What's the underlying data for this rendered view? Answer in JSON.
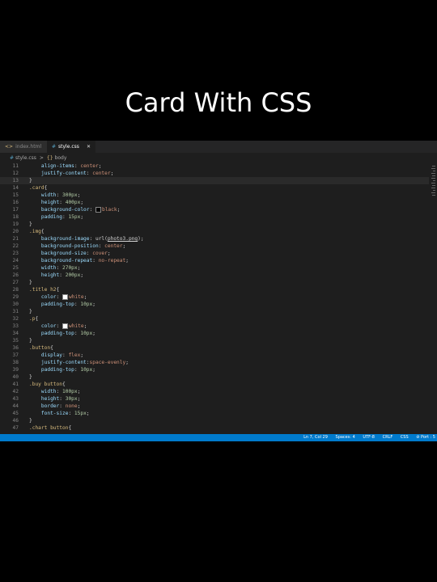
{
  "headline": "Card With CSS",
  "tabs": [
    {
      "icon": "<>",
      "label": "index.html",
      "active": false
    },
    {
      "icon": "#",
      "label": "style.css",
      "active": true,
      "close": "✕"
    }
  ],
  "breadcrumb": {
    "file_icon": "#",
    "file": "style.css",
    "separator": ">",
    "node_icon": "{}",
    "node": "body"
  },
  "code_lines": [
    {
      "n": "11",
      "tokens": [
        {
          "t": "    "
        },
        {
          "c": "prop",
          "t": "align-items"
        },
        {
          "c": "pun",
          "t": ": "
        },
        {
          "c": "val",
          "t": "center"
        },
        {
          "c": "pun",
          "t": ";"
        }
      ]
    },
    {
      "n": "12",
      "tokens": [
        {
          "t": "    "
        },
        {
          "c": "prop",
          "t": "justify-content"
        },
        {
          "c": "pun",
          "t": ": "
        },
        {
          "c": "val",
          "t": "center"
        },
        {
          "c": "pun",
          "t": ";"
        }
      ]
    },
    {
      "n": "13",
      "cur": true,
      "tokens": [
        {
          "c": "pun",
          "t": "}"
        }
      ]
    },
    {
      "n": "14",
      "tokens": [
        {
          "c": "sel",
          "t": ".card"
        },
        {
          "c": "pun",
          "t": "{"
        }
      ]
    },
    {
      "n": "15",
      "tokens": [
        {
          "t": "    "
        },
        {
          "c": "prop",
          "t": "width"
        },
        {
          "c": "pun",
          "t": ": "
        },
        {
          "c": "num",
          "t": "300px"
        },
        {
          "c": "pun",
          "t": ";"
        }
      ]
    },
    {
      "n": "16",
      "tokens": [
        {
          "t": "    "
        },
        {
          "c": "prop",
          "t": "height"
        },
        {
          "c": "pun",
          "t": ": "
        },
        {
          "c": "num",
          "t": "400px"
        },
        {
          "c": "pun",
          "t": ";"
        }
      ]
    },
    {
      "n": "17",
      "tokens": [
        {
          "t": "    "
        },
        {
          "c": "prop",
          "t": "background-color"
        },
        {
          "c": "pun",
          "t": ": "
        },
        {
          "c": "swatch-black",
          "t": ""
        },
        {
          "c": "val",
          "t": "black"
        },
        {
          "c": "pun",
          "t": ";"
        }
      ]
    },
    {
      "n": "18",
      "tokens": [
        {
          "t": "    "
        },
        {
          "c": "prop",
          "t": "padding"
        },
        {
          "c": "pun",
          "t": ": "
        },
        {
          "c": "num",
          "t": "15px"
        },
        {
          "c": "pun",
          "t": ";"
        }
      ]
    },
    {
      "n": "19",
      "tokens": [
        {
          "c": "pun",
          "t": "}"
        }
      ]
    },
    {
      "n": "20",
      "tokens": [
        {
          "c": "sel",
          "t": ".img"
        },
        {
          "c": "pun",
          "t": "{"
        }
      ]
    },
    {
      "n": "21",
      "tokens": [
        {
          "t": "    "
        },
        {
          "c": "prop",
          "t": "background-image"
        },
        {
          "c": "pun",
          "t": ": url("
        },
        {
          "c": "url",
          "t": "photo3.png"
        },
        {
          "c": "pun",
          "t": ");"
        }
      ]
    },
    {
      "n": "22",
      "tokens": [
        {
          "t": "    "
        },
        {
          "c": "prop",
          "t": "background-position"
        },
        {
          "c": "pun",
          "t": ": "
        },
        {
          "c": "val",
          "t": "center"
        },
        {
          "c": "pun",
          "t": ";"
        }
      ]
    },
    {
      "n": "23",
      "tokens": [
        {
          "t": "    "
        },
        {
          "c": "prop",
          "t": "background-size"
        },
        {
          "c": "pun",
          "t": ": "
        },
        {
          "c": "val",
          "t": "cover"
        },
        {
          "c": "pun",
          "t": ";"
        }
      ]
    },
    {
      "n": "24",
      "tokens": [
        {
          "t": "    "
        },
        {
          "c": "prop",
          "t": "background-repeat"
        },
        {
          "c": "pun",
          "t": ": "
        },
        {
          "c": "val",
          "t": "no-repeat"
        },
        {
          "c": "pun",
          "t": ";"
        }
      ]
    },
    {
      "n": "25",
      "tokens": [
        {
          "t": "    "
        },
        {
          "c": "prop",
          "t": "width"
        },
        {
          "c": "pun",
          "t": ": "
        },
        {
          "c": "num",
          "t": "270px"
        },
        {
          "c": "pun",
          "t": ";"
        }
      ]
    },
    {
      "n": "26",
      "tokens": [
        {
          "t": "    "
        },
        {
          "c": "prop",
          "t": "height"
        },
        {
          "c": "pun",
          "t": ": "
        },
        {
          "c": "num",
          "t": "200px"
        },
        {
          "c": "pun",
          "t": ";"
        }
      ]
    },
    {
      "n": "27",
      "tokens": [
        {
          "c": "pun",
          "t": "}"
        }
      ]
    },
    {
      "n": "28",
      "tokens": [
        {
          "c": "sel",
          "t": ".title h2"
        },
        {
          "c": "pun",
          "t": "{"
        }
      ]
    },
    {
      "n": "29",
      "tokens": [
        {
          "t": "    "
        },
        {
          "c": "prop",
          "t": "color"
        },
        {
          "c": "pun",
          "t": ": "
        },
        {
          "c": "swatch-white",
          "t": ""
        },
        {
          "c": "val",
          "t": "white"
        },
        {
          "c": "pun",
          "t": ";"
        }
      ]
    },
    {
      "n": "30",
      "tokens": [
        {
          "t": "    "
        },
        {
          "c": "prop",
          "t": "padding-top"
        },
        {
          "c": "pun",
          "t": ": "
        },
        {
          "c": "num",
          "t": "10px"
        },
        {
          "c": "pun",
          "t": ";"
        }
      ]
    },
    {
      "n": "31",
      "tokens": [
        {
          "c": "pun",
          "t": "}"
        }
      ]
    },
    {
      "n": "32",
      "tokens": [
        {
          "c": "sel",
          "t": ".p"
        },
        {
          "c": "pun",
          "t": "{"
        }
      ]
    },
    {
      "n": "33",
      "tokens": [
        {
          "t": "    "
        },
        {
          "c": "prop",
          "t": "color"
        },
        {
          "c": "pun",
          "t": ": "
        },
        {
          "c": "swatch-white",
          "t": ""
        },
        {
          "c": "val",
          "t": "white"
        },
        {
          "c": "pun",
          "t": ";"
        }
      ]
    },
    {
      "n": "34",
      "tokens": [
        {
          "t": "    "
        },
        {
          "c": "prop",
          "t": "padding-top"
        },
        {
          "c": "pun",
          "t": ": "
        },
        {
          "c": "num",
          "t": "10px"
        },
        {
          "c": "pun",
          "t": ";"
        }
      ]
    },
    {
      "n": "35",
      "tokens": [
        {
          "c": "pun",
          "t": "}"
        }
      ]
    },
    {
      "n": "36",
      "tokens": [
        {
          "c": "sel",
          "t": ".button"
        },
        {
          "c": "pun",
          "t": "{"
        }
      ]
    },
    {
      "n": "37",
      "tokens": [
        {
          "t": "    "
        },
        {
          "c": "prop",
          "t": "display"
        },
        {
          "c": "pun",
          "t": ": "
        },
        {
          "c": "val",
          "t": "flex"
        },
        {
          "c": "pun",
          "t": ";"
        }
      ]
    },
    {
      "n": "38",
      "tokens": [
        {
          "t": "    "
        },
        {
          "c": "prop",
          "t": "justify-content"
        },
        {
          "c": "pun",
          "t": ":"
        },
        {
          "c": "val",
          "t": "space-evenly"
        },
        {
          "c": "pun",
          "t": ";"
        }
      ]
    },
    {
      "n": "39",
      "tokens": [
        {
          "t": "    "
        },
        {
          "c": "prop",
          "t": "padding-top"
        },
        {
          "c": "pun",
          "t": ": "
        },
        {
          "c": "num",
          "t": "10px"
        },
        {
          "c": "pun",
          "t": ";"
        }
      ]
    },
    {
      "n": "40",
      "tokens": [
        {
          "c": "pun",
          "t": "}"
        }
      ]
    },
    {
      "n": "41",
      "tokens": [
        {
          "c": "sel",
          "t": ".buy button"
        },
        {
          "c": "pun",
          "t": "{"
        }
      ]
    },
    {
      "n": "42",
      "tokens": [
        {
          "t": "    "
        },
        {
          "c": "prop",
          "t": "width"
        },
        {
          "c": "pun",
          "t": ": "
        },
        {
          "c": "num",
          "t": "100px"
        },
        {
          "c": "pun",
          "t": ";"
        }
      ]
    },
    {
      "n": "43",
      "tokens": [
        {
          "t": "    "
        },
        {
          "c": "prop",
          "t": "height"
        },
        {
          "c": "pun",
          "t": ": "
        },
        {
          "c": "num",
          "t": "30px"
        },
        {
          "c": "pun",
          "t": ";"
        }
      ]
    },
    {
      "n": "44",
      "tokens": [
        {
          "t": "    "
        },
        {
          "c": "prop",
          "t": "border"
        },
        {
          "c": "pun",
          "t": ": "
        },
        {
          "c": "val",
          "t": "none"
        },
        {
          "c": "pun",
          "t": ";"
        }
      ]
    },
    {
      "n": "45",
      "tokens": [
        {
          "t": "    "
        },
        {
          "c": "prop",
          "t": "font-size"
        },
        {
          "c": "pun",
          "t": ": "
        },
        {
          "c": "num",
          "t": "15px"
        },
        {
          "c": "pun",
          "t": ";"
        }
      ]
    },
    {
      "n": "46",
      "tokens": [
        {
          "c": "pun",
          "t": "}"
        }
      ]
    },
    {
      "n": "47",
      "tokens": [
        {
          "c": "sel",
          "t": ".chart button"
        },
        {
          "c": "pun",
          "t": "{"
        }
      ]
    }
  ],
  "statusbar": {
    "position": "Ln 7, Col 29",
    "spaces": "Spaces: 4",
    "encoding": "UTF-8",
    "eol": "CRLF",
    "language": "CSS",
    "port": "⊘ Port : 5"
  },
  "colors": {
    "accent": "#007acc",
    "selector": "#d7ba7d",
    "property": "#9cdcfe",
    "value": "#ce9178",
    "number": "#b5cea8"
  }
}
